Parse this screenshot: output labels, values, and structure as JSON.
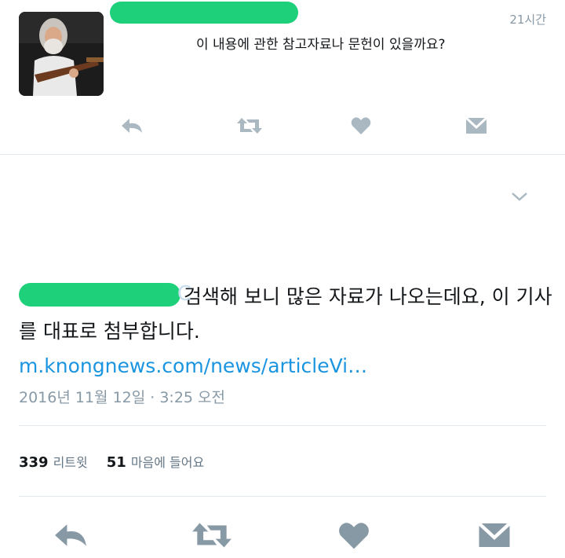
{
  "reply": {
    "timestamp": "21시간",
    "text": "이 내용에 관한 참고자료나 문헌이 있을까요?"
  },
  "main": {
    "text": "검색해 보니 많은 자료가 나오는데요, 이 기사를 대표로 첨부합니다.",
    "link": "m.knongnews.com/news/articleVi…",
    "date": "2016년 11월 12일 · 3:25 오전"
  },
  "stats": {
    "retweets_count": "339",
    "retweets_label": "리트윗",
    "likes_count": "51",
    "likes_label": "마음에 들어요"
  },
  "colors": {
    "icon_gray": "#aab8c2",
    "icon_dark": "#8899a6",
    "link": "#1b95e0",
    "redaction": "#1fd07a"
  },
  "icons": [
    "reply-icon",
    "retweet-icon",
    "like-icon",
    "dm-icon",
    "chevron-down-icon"
  ]
}
